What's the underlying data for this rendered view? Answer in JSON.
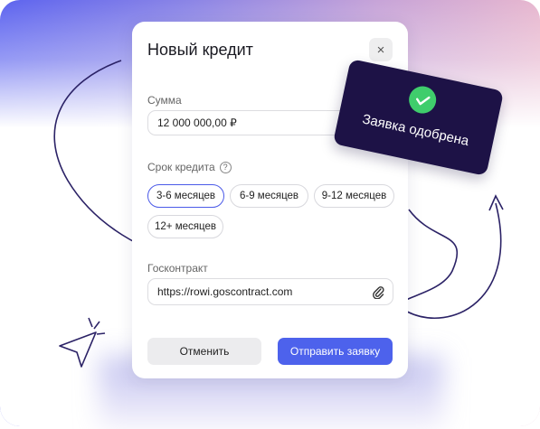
{
  "dialog": {
    "title": "Новый кредит",
    "close_icon": "×",
    "amount_label": "Сумма",
    "amount_value": "12 000 000,00 ₽",
    "term_label": "Срок кредита",
    "help_icon": "?",
    "term_options": [
      "3-6 месяцев",
      "6-9 месяцев",
      "9-12 месяцев",
      "12+ месяцев"
    ],
    "term_selected": "3-6 месяцев",
    "contract_label": "Госконтракт",
    "contract_value": "https://rowi.goscontract.com",
    "cancel_label": "Отменить",
    "submit_label": "Отправить заявку"
  },
  "badge": {
    "text": "Заявка одобрена"
  },
  "colors": {
    "accent": "#4d62ec",
    "badge_bg": "#1d1246",
    "success": "#3fcd6c",
    "gradient_left": "#5d64ef",
    "gradient_right": "#e7b7cf"
  }
}
